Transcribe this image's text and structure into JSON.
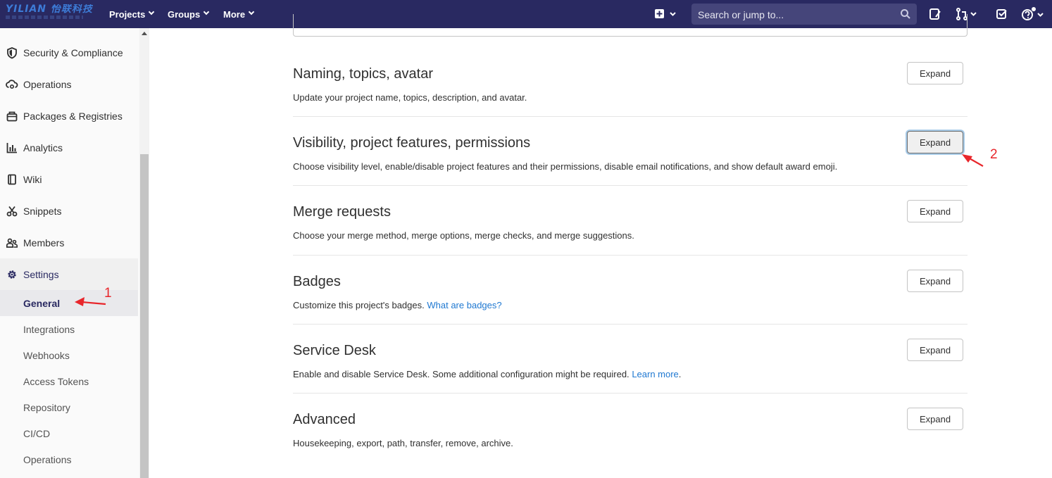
{
  "navbar": {
    "logo_text": "YILIAN 怡联科技",
    "projects_label": "Projects",
    "groups_label": "Groups",
    "more_label": "More",
    "search_placeholder": "Search or jump to...",
    "colors": {
      "navbar_bg": "#292961",
      "search_bg": "#45457a"
    },
    "icons": [
      "plus-square-icon",
      "chevron-down-icon",
      "search-icon",
      "issues-icon",
      "merge-request-icon",
      "todo-icon",
      "help-icon"
    ]
  },
  "sidebar": {
    "items": [
      {
        "label": "Security & Compliance",
        "icon": "shield-icon"
      },
      {
        "label": "Operations",
        "icon": "cloud-gear-icon"
      },
      {
        "label": "Packages & Registries",
        "icon": "package-icon"
      },
      {
        "label": "Analytics",
        "icon": "chart-icon"
      },
      {
        "label": "Wiki",
        "icon": "book-icon"
      },
      {
        "label": "Snippets",
        "icon": "scissors-icon"
      },
      {
        "label": "Members",
        "icon": "users-icon"
      },
      {
        "label": "Settings",
        "icon": "gear-icon"
      }
    ],
    "sub_items": [
      {
        "label": "General",
        "active": true
      },
      {
        "label": "Integrations"
      },
      {
        "label": "Webhooks"
      },
      {
        "label": "Access Tokens"
      },
      {
        "label": "Repository"
      },
      {
        "label": "CI/CD"
      },
      {
        "label": "Operations"
      }
    ]
  },
  "sections": [
    {
      "title": "Naming, topics, avatar",
      "description": "Update your project name, topics, description, and avatar.",
      "button": "Expand"
    },
    {
      "title": "Visibility, project features, permissions",
      "description": "Choose visibility level, enable/disable project features and their permissions, disable email notifications, and show default award emoji.",
      "button": "Expand"
    },
    {
      "title": "Merge requests",
      "description": "Choose your merge method, merge options, merge checks, and merge suggestions.",
      "button": "Expand"
    },
    {
      "title": "Badges",
      "description": "Customize this project's badges.",
      "link": "What are badges?",
      "button": "Expand"
    },
    {
      "title": "Service Desk",
      "description": "Enable and disable Service Desk. Some additional configuration might be required.",
      "link": "Learn more",
      "link_suffix": ".",
      "button": "Expand"
    },
    {
      "title": "Advanced",
      "description": "Housekeeping, export, path, transfer, remove, archive.",
      "button": "Expand"
    }
  ],
  "annotations": {
    "one": "1",
    "two": "2",
    "color": "#e8262b"
  }
}
